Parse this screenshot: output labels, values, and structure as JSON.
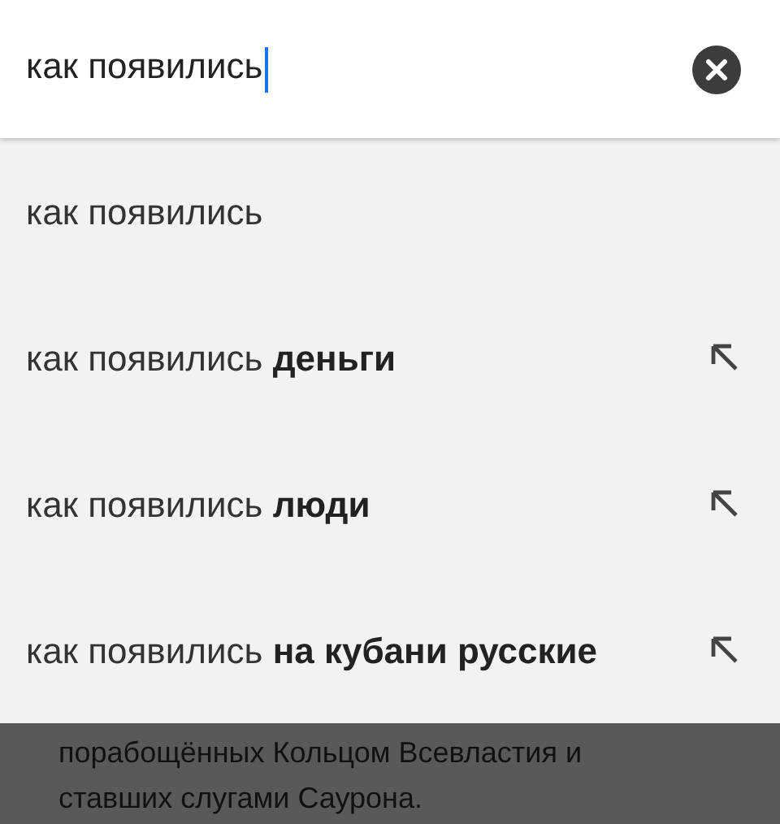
{
  "search": {
    "value": "как появились"
  },
  "suggestions": [
    {
      "text": "как появились",
      "fill_arrow": false
    },
    {
      "text": "как появились **деньги**",
      "fill_arrow": true
    },
    {
      "text": "как появились **люди**",
      "fill_arrow": true
    },
    {
      "text": "как появились **на кубани русские**",
      "fill_arrow": true
    }
  ],
  "background_text": "порабощённых Кольцом Всевластия и ставших слугами Саурона."
}
